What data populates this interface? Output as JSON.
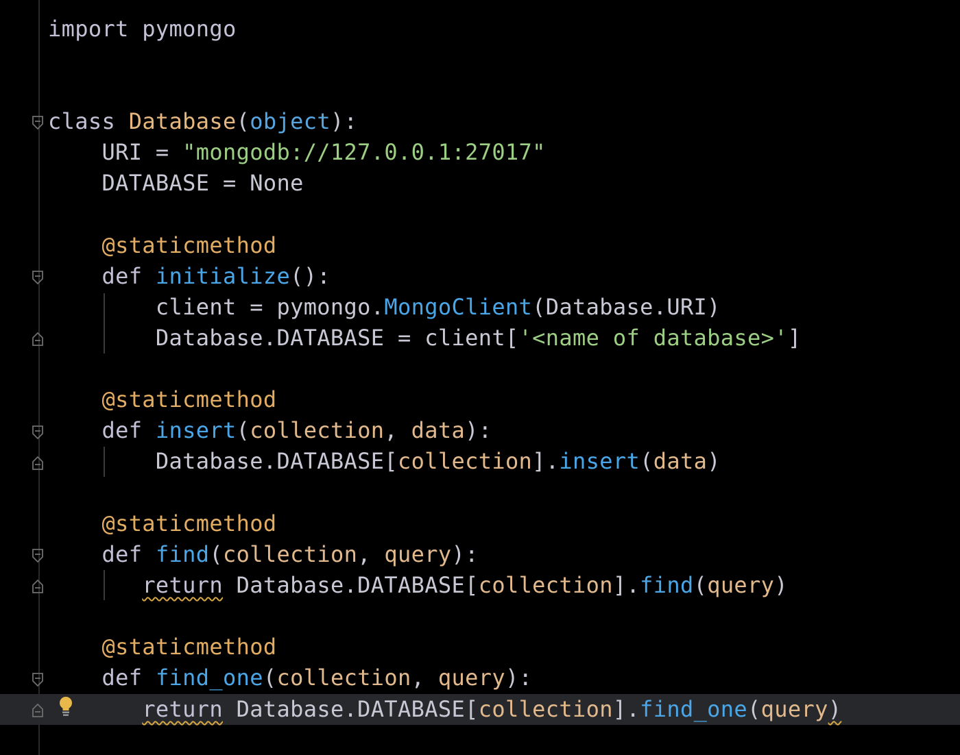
{
  "editor": {
    "lines": [
      {
        "parts": [
          "import pymongo"
        ]
      },
      {
        "parts": [
          "class ",
          "Database",
          "(",
          "object",
          "):"
        ]
      },
      {
        "parts": [
          "    URI = ",
          "\"mongodb://127.0.0.1:27017\""
        ]
      },
      {
        "parts": [
          "    DATABASE = None"
        ]
      },
      {
        "parts": [
          "    @staticmethod"
        ]
      },
      {
        "parts": [
          "    def ",
          "initialize",
          "():"
        ]
      },
      {
        "parts": [
          "        client = pymongo.",
          "MongoClient",
          "(Database.URI)"
        ]
      },
      {
        "parts": [
          "        Database.DATABASE = client[",
          "'<name of database>'",
          "]"
        ]
      },
      {
        "parts": [
          "    @staticmethod"
        ]
      },
      {
        "parts": [
          "    def ",
          "insert",
          "(",
          "collection",
          ", ",
          "data",
          "):"
        ]
      },
      {
        "parts": [
          "        Database.DATABASE[",
          "collection",
          "].",
          "insert",
          "(",
          "data",
          ")"
        ]
      },
      {
        "parts": [
          "    @staticmethod"
        ]
      },
      {
        "parts": [
          "    def ",
          "find",
          "(",
          "collection",
          ", ",
          "query",
          "):"
        ]
      },
      {
        "parts": [
          "       ",
          "return",
          " Database.DATABASE[",
          "collection",
          "].",
          "find",
          "(",
          "query",
          ")"
        ]
      },
      {
        "parts": [
          "    @staticmethod"
        ]
      },
      {
        "parts": [
          "    def ",
          "find_one",
          "(",
          "collection",
          ", ",
          "query",
          "):"
        ]
      },
      {
        "parts": [
          "       ",
          "return",
          " Database.DATABASE[",
          "collection",
          "].",
          "find_one",
          "(",
          "query",
          ")"
        ]
      }
    ],
    "colors": {
      "background": "#000000",
      "keyword": "#c4c0d6",
      "class_name": "#e6b77e",
      "builtin": "#58a6e0",
      "string": "#9ccf84",
      "decorator": "#e2ad63",
      "function": "#4aa6e6",
      "parameter": "#e2b98c",
      "warning_underline": "#d7a645",
      "current_line": "#26282b"
    },
    "icons": {
      "fold_open": "fold-open-icon",
      "fold_close": "fold-close-icon",
      "intention_bulb": "lightbulb-icon"
    }
  }
}
